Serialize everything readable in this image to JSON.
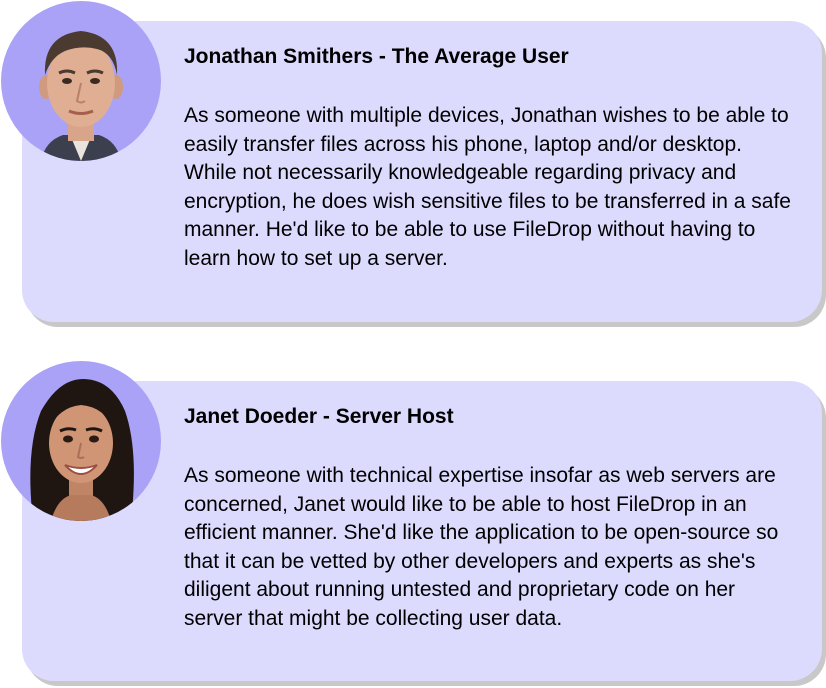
{
  "personas": [
    {
      "name": "Jonathan Smithers - The Average User",
      "description": "As someone with multiple devices, Jonathan wishes to be able to easily transfer files across his phone, laptop and/or desktop. While not necessarily knowledgeable regarding privacy and encryption, he does wish sensitive files to be transferred in a safe manner. He'd like to be able to use FileDrop without having to learn how to set up a server.",
      "avatar_icon": "man-portrait-icon"
    },
    {
      "name": "Janet Doeder - Server Host",
      "description": "As someone with technical expertise insofar as web servers are concerned, Janet would like to be able to host FileDrop in an efficient manner. She'd like the application to be open-source so that it can be vetted by other developers and experts as she's diligent about running untested and proprietary code on her server that might be collecting user data.",
      "avatar_icon": "woman-portrait-icon"
    }
  ],
  "colors": {
    "card_background": "#dcdafd",
    "avatar_background": "#a9a2f7",
    "card_shadow": "#c8c8c8"
  }
}
